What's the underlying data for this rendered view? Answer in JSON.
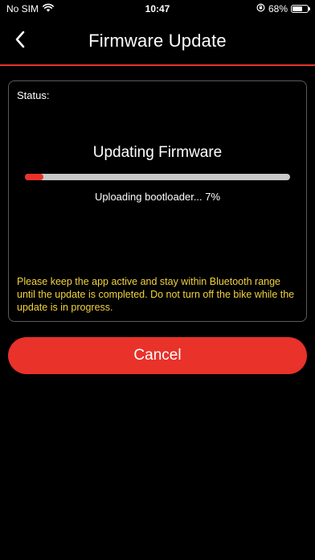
{
  "status_bar": {
    "carrier": "No SIM",
    "time": "10:47",
    "battery_percent_label": "68%",
    "battery_level": 0.68
  },
  "header": {
    "title": "Firmware Update"
  },
  "panel": {
    "status_label": "Status:",
    "heading": "Updating Firmware",
    "progress_text": "Uploading bootloader... 7%",
    "progress_value": 0.07,
    "warning": "Please keep the app active and stay within Bluetooth range until the update is completed. Do not turn off the bike while the update is in progress."
  },
  "actions": {
    "cancel_label": "Cancel"
  },
  "colors": {
    "accent": "#e8322a",
    "warning_text": "#f2d23c",
    "track": "#c8c8c8",
    "background": "#000000"
  },
  "icons": {
    "wifi": "wifi-icon",
    "rotation_lock": "rotation-lock-icon",
    "battery": "battery-icon",
    "back": "chevron-left-icon"
  }
}
